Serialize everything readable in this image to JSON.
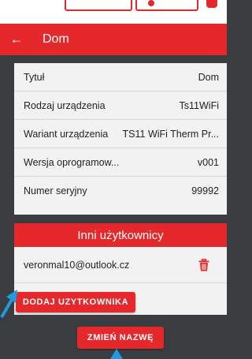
{
  "header": {
    "title": "Dom"
  },
  "device_info": [
    {
      "label": "Tytuł",
      "value": "Dom"
    },
    {
      "label": "Rodzaj urządzenia",
      "value": "Ts11WiFi"
    },
    {
      "label": "Wariant urządzenia",
      "value": "TS11 WiFi Therm Pr..."
    },
    {
      "label": "Wersja oprogramow...",
      "value": "v001"
    },
    {
      "label": "Numer seryjny",
      "value": "99992"
    }
  ],
  "users": {
    "title": "Inni użytkownicy",
    "items": [
      {
        "email": "veronmal10@outlook.cz"
      }
    ],
    "add_button": "DODAJ UZYTKOWNIKA"
  },
  "rename_button": "ZMIEŃ NAZWĘ",
  "colors": {
    "accent": "#e5282c",
    "background": "#3a3d3f",
    "card": "#f2f2f2",
    "pointer": "#1e9be0"
  }
}
